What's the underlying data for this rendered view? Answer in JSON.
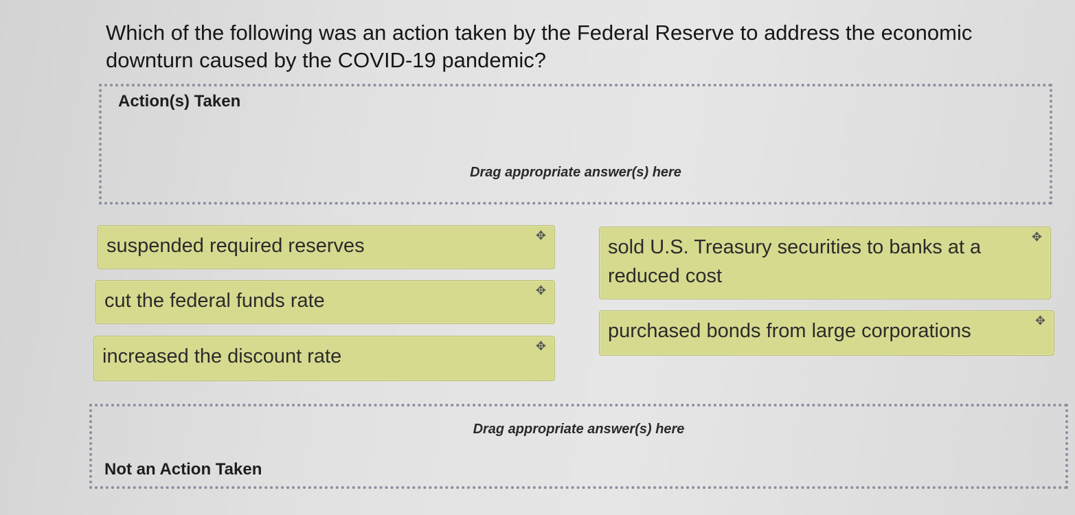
{
  "question": "Which of the following was an action taken by the Federal Reserve to address the economic downturn caused by the COVID-19 pandemic?",
  "zones": [
    {
      "label": "Action(s) Taken",
      "hint": "Drag appropriate answer(s) here"
    },
    {
      "label": "Not an Action Taken",
      "hint": "Drag appropriate answer(s) here"
    }
  ],
  "tiles": [
    {
      "label": "suspended required reserves",
      "icon": "move-icon"
    },
    {
      "label": "cut the federal funds rate",
      "icon": "move-icon"
    },
    {
      "label": "increased the discount rate",
      "icon": "move-icon"
    },
    {
      "label": "sold U.S. Treasury securities to banks at a reduced cost",
      "icon": "move-icon"
    },
    {
      "label": "purchased bonds from large corporations",
      "icon": "move-icon"
    }
  ],
  "colors": {
    "tile_background": "#d6da8e",
    "dropzone_border": "#8a8ea0"
  }
}
